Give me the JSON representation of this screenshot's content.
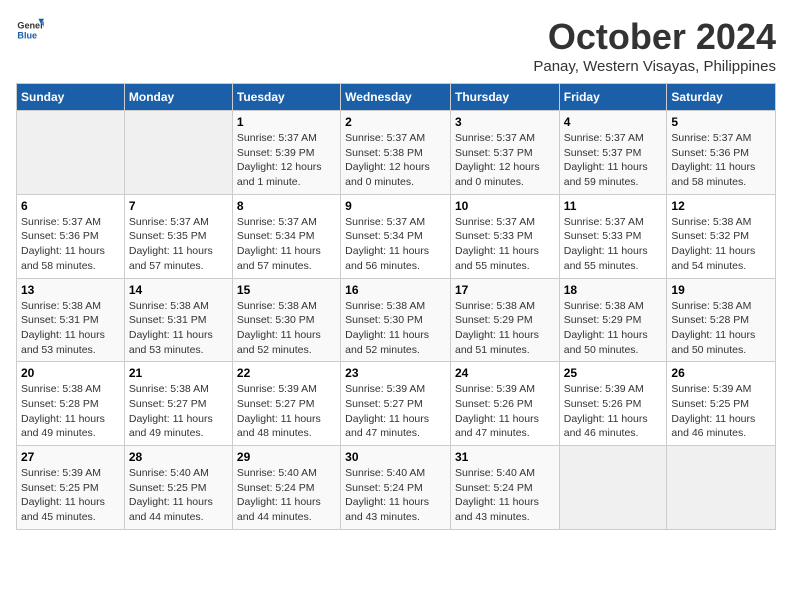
{
  "header": {
    "logo_general": "General",
    "logo_blue": "Blue",
    "month_title": "October 2024",
    "subtitle": "Panay, Western Visayas, Philippines"
  },
  "weekdays": [
    "Sunday",
    "Monday",
    "Tuesday",
    "Wednesday",
    "Thursday",
    "Friday",
    "Saturday"
  ],
  "weeks": [
    [
      {
        "day": "",
        "info": ""
      },
      {
        "day": "",
        "info": ""
      },
      {
        "day": "1",
        "info": "Sunrise: 5:37 AM\nSunset: 5:39 PM\nDaylight: 12 hours\nand 1 minute."
      },
      {
        "day": "2",
        "info": "Sunrise: 5:37 AM\nSunset: 5:38 PM\nDaylight: 12 hours\nand 0 minutes."
      },
      {
        "day": "3",
        "info": "Sunrise: 5:37 AM\nSunset: 5:37 PM\nDaylight: 12 hours\nand 0 minutes."
      },
      {
        "day": "4",
        "info": "Sunrise: 5:37 AM\nSunset: 5:37 PM\nDaylight: 11 hours\nand 59 minutes."
      },
      {
        "day": "5",
        "info": "Sunrise: 5:37 AM\nSunset: 5:36 PM\nDaylight: 11 hours\nand 58 minutes."
      }
    ],
    [
      {
        "day": "6",
        "info": "Sunrise: 5:37 AM\nSunset: 5:36 PM\nDaylight: 11 hours\nand 58 minutes."
      },
      {
        "day": "7",
        "info": "Sunrise: 5:37 AM\nSunset: 5:35 PM\nDaylight: 11 hours\nand 57 minutes."
      },
      {
        "day": "8",
        "info": "Sunrise: 5:37 AM\nSunset: 5:34 PM\nDaylight: 11 hours\nand 57 minutes."
      },
      {
        "day": "9",
        "info": "Sunrise: 5:37 AM\nSunset: 5:34 PM\nDaylight: 11 hours\nand 56 minutes."
      },
      {
        "day": "10",
        "info": "Sunrise: 5:37 AM\nSunset: 5:33 PM\nDaylight: 11 hours\nand 55 minutes."
      },
      {
        "day": "11",
        "info": "Sunrise: 5:37 AM\nSunset: 5:33 PM\nDaylight: 11 hours\nand 55 minutes."
      },
      {
        "day": "12",
        "info": "Sunrise: 5:38 AM\nSunset: 5:32 PM\nDaylight: 11 hours\nand 54 minutes."
      }
    ],
    [
      {
        "day": "13",
        "info": "Sunrise: 5:38 AM\nSunset: 5:31 PM\nDaylight: 11 hours\nand 53 minutes."
      },
      {
        "day": "14",
        "info": "Sunrise: 5:38 AM\nSunset: 5:31 PM\nDaylight: 11 hours\nand 53 minutes."
      },
      {
        "day": "15",
        "info": "Sunrise: 5:38 AM\nSunset: 5:30 PM\nDaylight: 11 hours\nand 52 minutes."
      },
      {
        "day": "16",
        "info": "Sunrise: 5:38 AM\nSunset: 5:30 PM\nDaylight: 11 hours\nand 52 minutes."
      },
      {
        "day": "17",
        "info": "Sunrise: 5:38 AM\nSunset: 5:29 PM\nDaylight: 11 hours\nand 51 minutes."
      },
      {
        "day": "18",
        "info": "Sunrise: 5:38 AM\nSunset: 5:29 PM\nDaylight: 11 hours\nand 50 minutes."
      },
      {
        "day": "19",
        "info": "Sunrise: 5:38 AM\nSunset: 5:28 PM\nDaylight: 11 hours\nand 50 minutes."
      }
    ],
    [
      {
        "day": "20",
        "info": "Sunrise: 5:38 AM\nSunset: 5:28 PM\nDaylight: 11 hours\nand 49 minutes."
      },
      {
        "day": "21",
        "info": "Sunrise: 5:38 AM\nSunset: 5:27 PM\nDaylight: 11 hours\nand 49 minutes."
      },
      {
        "day": "22",
        "info": "Sunrise: 5:39 AM\nSunset: 5:27 PM\nDaylight: 11 hours\nand 48 minutes."
      },
      {
        "day": "23",
        "info": "Sunrise: 5:39 AM\nSunset: 5:27 PM\nDaylight: 11 hours\nand 47 minutes."
      },
      {
        "day": "24",
        "info": "Sunrise: 5:39 AM\nSunset: 5:26 PM\nDaylight: 11 hours\nand 47 minutes."
      },
      {
        "day": "25",
        "info": "Sunrise: 5:39 AM\nSunset: 5:26 PM\nDaylight: 11 hours\nand 46 minutes."
      },
      {
        "day": "26",
        "info": "Sunrise: 5:39 AM\nSunset: 5:25 PM\nDaylight: 11 hours\nand 46 minutes."
      }
    ],
    [
      {
        "day": "27",
        "info": "Sunrise: 5:39 AM\nSunset: 5:25 PM\nDaylight: 11 hours\nand 45 minutes."
      },
      {
        "day": "28",
        "info": "Sunrise: 5:40 AM\nSunset: 5:25 PM\nDaylight: 11 hours\nand 44 minutes."
      },
      {
        "day": "29",
        "info": "Sunrise: 5:40 AM\nSunset: 5:24 PM\nDaylight: 11 hours\nand 44 minutes."
      },
      {
        "day": "30",
        "info": "Sunrise: 5:40 AM\nSunset: 5:24 PM\nDaylight: 11 hours\nand 43 minutes."
      },
      {
        "day": "31",
        "info": "Sunrise: 5:40 AM\nSunset: 5:24 PM\nDaylight: 11 hours\nand 43 minutes."
      },
      {
        "day": "",
        "info": ""
      },
      {
        "day": "",
        "info": ""
      }
    ]
  ]
}
